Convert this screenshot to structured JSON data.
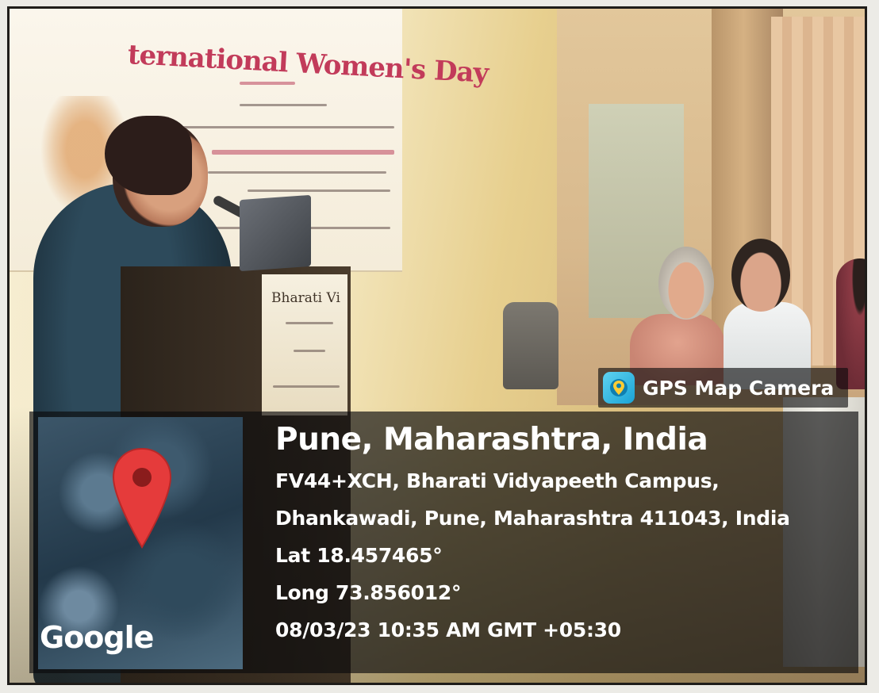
{
  "banner": {
    "title": "ternational Women's Day"
  },
  "podium_plate": {
    "text": "Bharati Vi"
  },
  "gps_camera": {
    "app_label": "GPS Map Camera",
    "app_icon": "gps-map-camera-icon",
    "map_brand": "Google",
    "map_pin_color": "#e53b3b",
    "location_title": "Pune, Maharashtra, India",
    "address_line_1": "FV44+XCH, Bharati Vidyapeeth Campus,",
    "address_line_2": "Dhankawadi, Pune, Maharashtra 411043, India",
    "latitude": "Lat 18.457465°",
    "longitude": "Long 73.856012°",
    "timestamp": "08/03/23 10:35 AM GMT +05:30"
  }
}
